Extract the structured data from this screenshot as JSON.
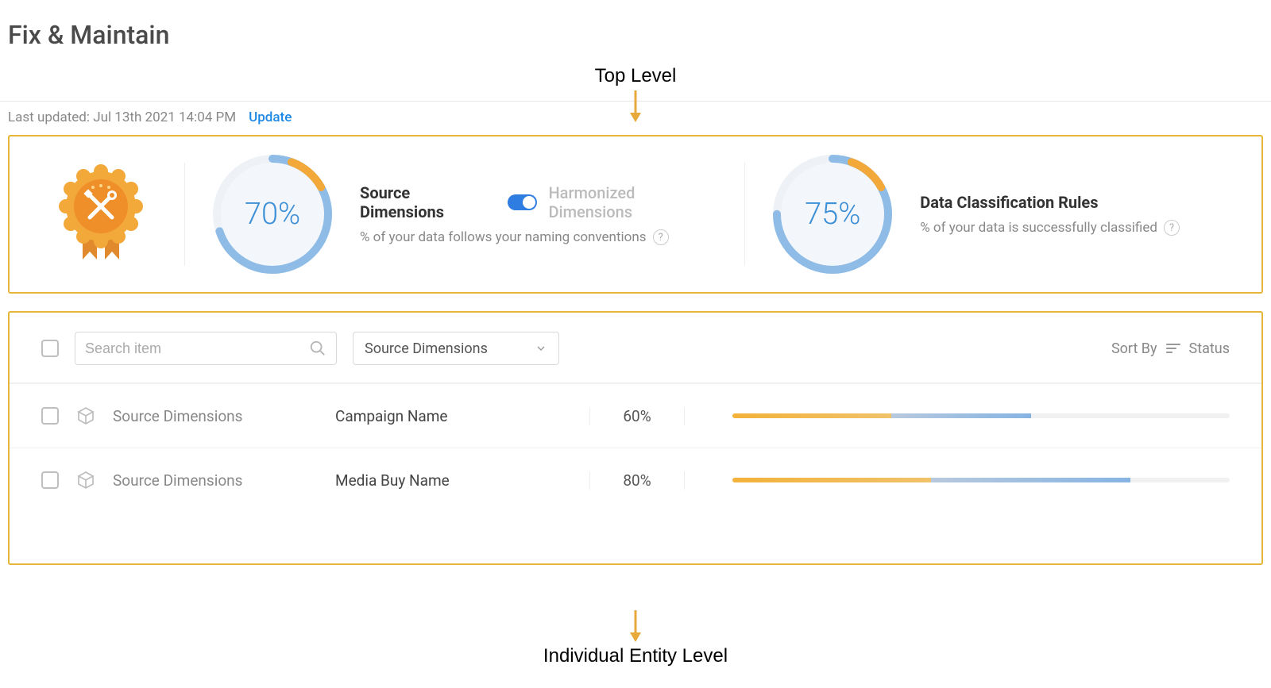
{
  "page_title": "Fix & Maintain",
  "annotations": {
    "top": "Top Level",
    "bottom": "Individual Entity Level"
  },
  "last_updated_label": "Last updated: Jul 13th 2021 14:04 PM",
  "update_link": "Update",
  "metrics": {
    "source": {
      "percent": 70,
      "percent_label": "70%",
      "title_active": "Source Dimensions",
      "title_inactive": "Harmonized Dimensions",
      "subtitle": "% of your data follows your naming conventions"
    },
    "classification": {
      "percent": 75,
      "percent_label": "75%",
      "title": "Data Classification Rules",
      "subtitle": "% of your data is successfully classified"
    }
  },
  "table": {
    "search_placeholder": "Search item",
    "filter_value": "Source Dimensions",
    "sort_by_label": "Sort By",
    "sort_by_value": "Status",
    "rows": [
      {
        "category": "Source Dimensions",
        "entity": "Campaign Name",
        "percent": 60,
        "percent_label": "60%",
        "orange": 32,
        "blue": 28
      },
      {
        "category": "Source Dimensions",
        "entity": "Media Buy Name",
        "percent": 80,
        "percent_label": "80%",
        "orange": 40,
        "blue": 40
      }
    ]
  },
  "colors": {
    "accent_orange": "#f3a83a",
    "accent_blue": "#3d8fd6",
    "highlight": "#e6b63a"
  }
}
